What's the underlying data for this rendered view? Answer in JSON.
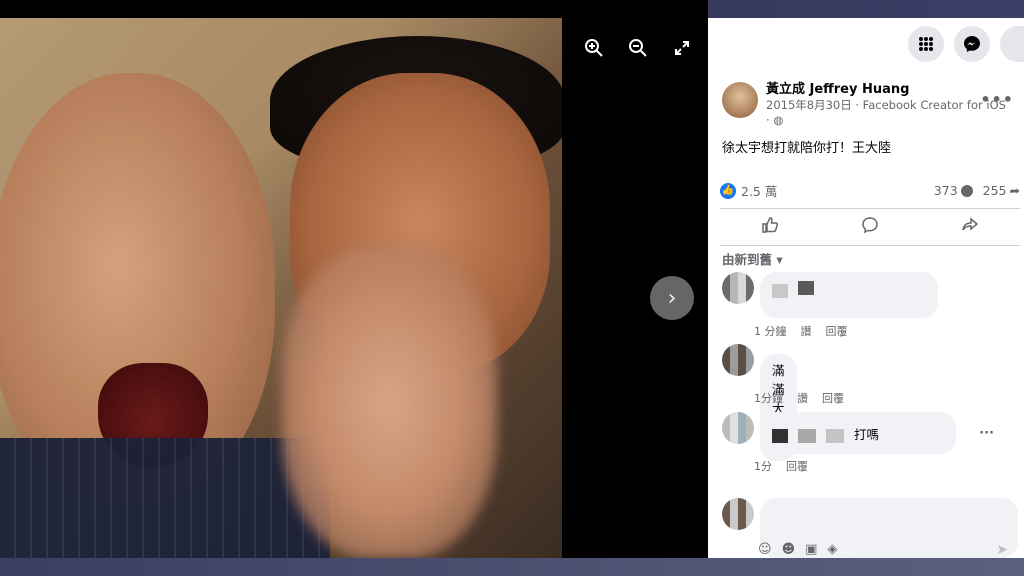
{
  "viewer": {
    "zoom_in_icon": "zoom-in-icon",
    "zoom_out_icon": "zoom-out-icon",
    "fullscreen_icon": "fullscreen-icon",
    "next_icon": "chevron-right-icon"
  },
  "topbar": {
    "menu_icon": "grid-menu-icon",
    "messenger_icon": "messenger-icon"
  },
  "post": {
    "author": "黃立成 Jeffrey Huang",
    "date": "2015年8月30日 · Facebook Creator for iOS ·",
    "text": "徐太宇想打就陪你打！王大陸",
    "reactions": "2.5 萬",
    "comments_count": "373",
    "shares_count": "255"
  },
  "sort_label": "由新到舊",
  "comments": [
    {
      "text": "",
      "time": "1 分鐘",
      "like": "讚",
      "reply": "回覆"
    },
    {
      "text": "滿滿大牢房",
      "time": "1分鐘",
      "like": "讚",
      "reply": "回覆"
    },
    {
      "text": "打嗎",
      "time": "1分",
      "like": "",
      "reply": "回覆"
    }
  ],
  "colors": {
    "accent": "#1877f2",
    "panel_bg": "#ffffff",
    "bubble_bg": "#f0f2f5"
  }
}
